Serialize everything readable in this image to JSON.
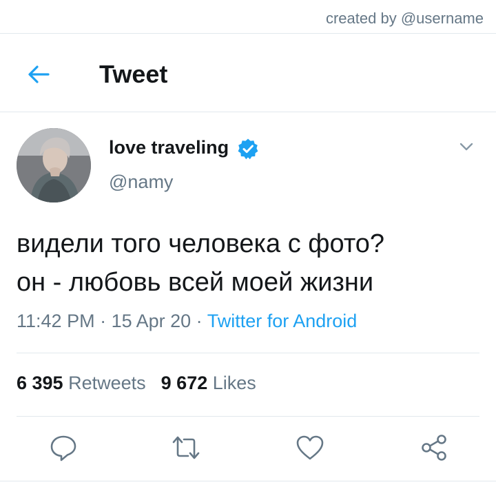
{
  "credit": "created by @username",
  "header": {
    "title": "Tweet",
    "back_icon": "arrow-left-icon"
  },
  "tweet": {
    "author": {
      "display_name": "love traveling",
      "handle": "@namy",
      "verified": true
    },
    "text_lines": [
      "видели того человека с фото?",
      "он - любовь всей моей жизни"
    ],
    "time": "11:42 PM",
    "date": "15 Apr 20",
    "separator": " · ",
    "source": "Twitter for Android",
    "stats": {
      "retweets_count": "6 395",
      "retweets_label": "Retweets",
      "likes_count": "9 672",
      "likes_label": "Likes"
    }
  },
  "actions": [
    "reply-icon",
    "retweet-icon",
    "like-icon",
    "share-icon"
  ],
  "colors": {
    "accent": "#1da1f2",
    "text_primary": "#14171a",
    "text_secondary": "#657786",
    "divider": "#e1e8ed"
  }
}
